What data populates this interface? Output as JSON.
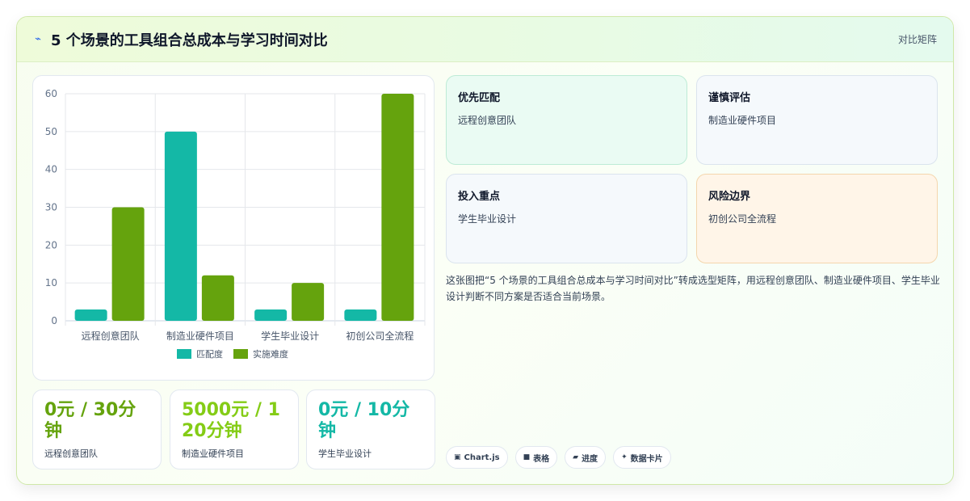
{
  "header": {
    "icon": "lightning-icon",
    "title": "5 个场景的工具组合总成本与学习时间对比",
    "right_label": "对比矩阵"
  },
  "colors": {
    "series1": "#14b8a6",
    "series2": "#65a30d",
    "stat1": "#65a30d",
    "stat2": "#84cc16",
    "stat3": "#14b8a6"
  },
  "chart_data": {
    "type": "bar",
    "categories": [
      "远程创意团队",
      "制造业硬件项目",
      "学生毕业设计",
      "初创公司全流程"
    ],
    "series": [
      {
        "name": "匹配度",
        "values": [
          3,
          50,
          3,
          3
        ]
      },
      {
        "name": "实施难度",
        "values": [
          30,
          12,
          10,
          60
        ]
      }
    ],
    "ylim": [
      0,
      60
    ],
    "yticks": [
      0,
      10,
      20,
      30,
      40,
      50,
      60
    ],
    "grid": true,
    "legend": "bottom"
  },
  "tiles": [
    {
      "title": "优先匹配",
      "text": "远程创意团队"
    },
    {
      "title": "谨慎评估",
      "text": "制造业硬件项目"
    },
    {
      "title": "投入重点",
      "text": "学生毕业设计"
    },
    {
      "title": "风险边界",
      "text": "初创公司全流程"
    }
  ],
  "description": "这张图把“5 个场景的工具组合总成本与学习时间对比”转成选型矩阵，用远程创意团队、制造业硬件项目、学生毕业设计判断不同方案是否适合当前场景。",
  "stats": [
    {
      "value": "0元 / 30分钟",
      "label": "远程创意团队"
    },
    {
      "value": "5000元 / 120分钟",
      "label": "制造业硬件项目"
    },
    {
      "value": "0元 / 10分钟",
      "label": "学生毕业设计"
    }
  ],
  "tags": [
    {
      "icon": "chart-icon",
      "glyph": "▣",
      "label": "Chart.js"
    },
    {
      "icon": "table-icon",
      "glyph": "■",
      "label": "表格"
    },
    {
      "icon": "progress-icon",
      "glyph": "▰",
      "label": "进度"
    },
    {
      "icon": "sparkle-icon",
      "glyph": "✦",
      "label": "数据卡片"
    }
  ]
}
